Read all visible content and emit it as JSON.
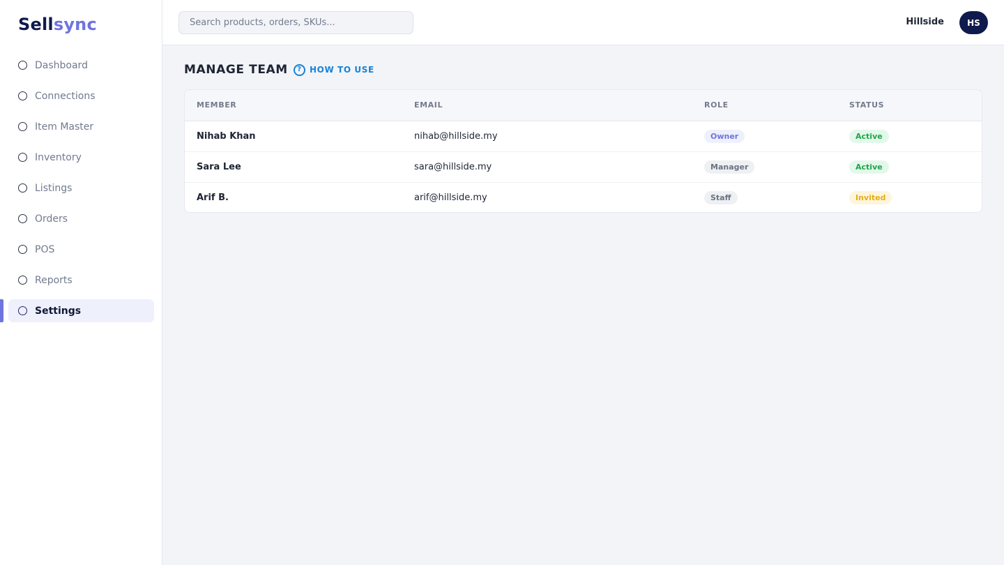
{
  "brand": {
    "name_part1": "Sell",
    "name_part2": "sync"
  },
  "sidebar": {
    "items": [
      {
        "label": "Dashboard",
        "icon": "circle-icon",
        "active": false
      },
      {
        "label": "Connections",
        "icon": "circle-icon",
        "active": false
      },
      {
        "label": "Item Master",
        "icon": "circle-icon",
        "active": false
      },
      {
        "label": "Inventory",
        "icon": "circle-icon",
        "active": false
      },
      {
        "label": "Listings",
        "icon": "circle-icon",
        "active": false
      },
      {
        "label": "Orders",
        "icon": "circle-icon",
        "active": false
      },
      {
        "label": "POS",
        "icon": "circle-icon",
        "active": false
      },
      {
        "label": "Reports",
        "icon": "circle-icon",
        "active": false
      },
      {
        "label": "Settings",
        "icon": "circle-icon",
        "active": true
      }
    ]
  },
  "header": {
    "search_placeholder": "Search products, orders, SKUs...",
    "search_value": "",
    "store_name": "Hillside",
    "avatar_initials": "HS"
  },
  "main": {
    "title": "MANAGE TEAM",
    "help_label": "HOW TO USE",
    "help_icon_glyph": "?",
    "table": {
      "columns": [
        "MEMBER",
        "EMAIL",
        "ROLE",
        "STATUS"
      ],
      "rows": [
        {
          "member": "Nihab Khan",
          "email": "nihab@hillside.my",
          "role": "Owner",
          "status": "Active"
        },
        {
          "member": "Sara Lee",
          "email": "sara@hillside.my",
          "role": "Manager",
          "status": "Active"
        },
        {
          "member": "Arif B.",
          "email": "arif@hillside.my",
          "role": "Staff",
          "status": "Invited"
        }
      ]
    }
  },
  "colors": {
    "accent": "#6f74e0",
    "brand_dark": "#0f1a4d",
    "link": "#1782d6",
    "status_active": "#1fa64a",
    "status_invited": "#e5ae13"
  }
}
